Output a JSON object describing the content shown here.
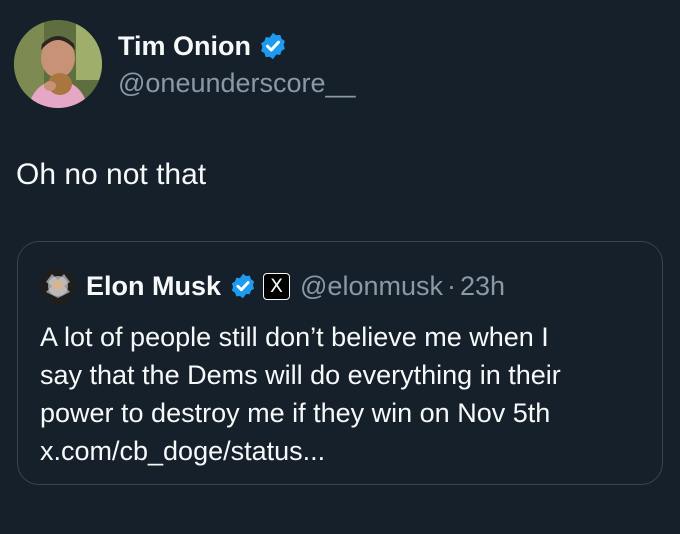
{
  "tweet": {
    "author": {
      "name": "Tim Onion",
      "handle": "@oneunderscore__",
      "avatar_icon": "profile-photo-avatar",
      "verified_icon": "verified-badge-icon"
    },
    "text": "Oh no not that"
  },
  "quoted_tweet": {
    "author": {
      "name": "Elon Musk",
      "handle": "@elonmusk",
      "avatar_icon": "profile-photo-avatar",
      "verified_icon": "verified-badge-icon",
      "affiliate_badge": "X"
    },
    "separator": "·",
    "time": "23h",
    "text_lines": [
      "A lot of people still don’t believe me when I",
      "say that the Dems will do everything in their",
      "power to destroy me if they win on Nov 5th",
      "x.com/cb_doge/status..."
    ]
  },
  "colors": {
    "background": "#15202b",
    "text_primary": "#f7f9f9",
    "text_secondary": "#8b98a5",
    "verified_blue": "#1d9bf0",
    "card_border": "#38444d"
  }
}
